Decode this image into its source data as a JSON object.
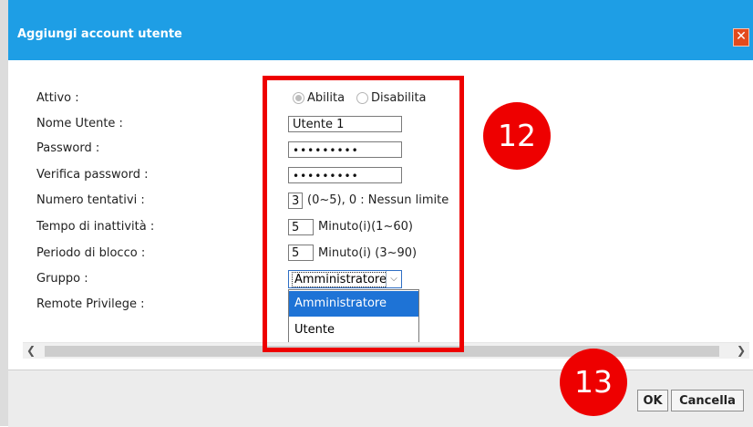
{
  "dialog": {
    "title": "Aggiungi account utente",
    "close_glyph": "✕"
  },
  "form": {
    "active_label": "Attivo :",
    "active_options": {
      "enable": "Abilita",
      "disable": "Disabilita"
    },
    "active_selected": "Abilita",
    "username_label": "Nome Utente :",
    "username_value": "Utente 1",
    "password_label": "Password :",
    "password_value": "•••••••••",
    "verify_label": "Verifica password :",
    "verify_value": "•••••••••",
    "attempts_label": "Numero tentativi :",
    "attempts_value": "3",
    "attempts_hint": "(0~5), 0 : Nessun limite",
    "inactivity_label": "Tempo di inattività :",
    "inactivity_value": "5",
    "inactivity_hint": "Minuto(i)(1~60)",
    "lockout_label": "Periodo di blocco :",
    "lockout_value": "5",
    "lockout_hint": "Minuto(i) (3~90)",
    "group_label": "Gruppo :",
    "group_selected": "Amministratore",
    "group_options": [
      "Amministratore",
      "Utente"
    ],
    "remote_label": "Remote Privilege :"
  },
  "footer": {
    "ok_label": "OK",
    "cancel_label": "Cancella"
  },
  "annotations": {
    "badge_12": "12",
    "badge_13": "13"
  },
  "colors": {
    "titlebar": "#1e9ee5",
    "highlight": "#ee0000",
    "dropdown_selected": "#1e73d6"
  },
  "icons": {
    "close": "close-icon",
    "chevron": "chevron-down-icon",
    "scroll_left": "arrow-left-icon",
    "scroll_right": "arrow-right-icon"
  }
}
